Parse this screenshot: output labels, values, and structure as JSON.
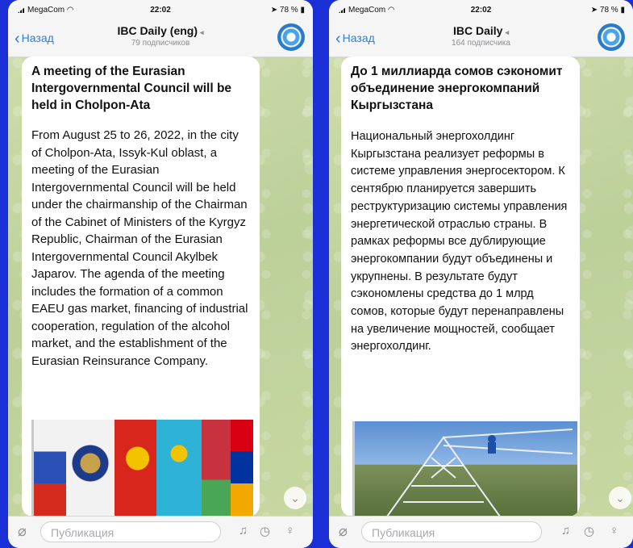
{
  "left": {
    "status": {
      "carrier": "MegaCom",
      "time": "22:02",
      "battery": "78 %"
    },
    "nav": {
      "back": "Назад",
      "title": "IBC Daily (eng)",
      "subscribers": "79 подписчиков"
    },
    "post": {
      "title": "A meeting of the Eurasian Intergovernmental Council will be held in Cholpon-Ata",
      "body": "From August 25 to 26, 2022, in the city of Cholpon-Ata, Issyk-Kul oblast, a meeting of the Eurasian Intergovernmental Council will be held under the chairmanship of the Chairman of the Cabinet of Ministers of the Kyrgyz Republic, Chairman of the Eurasian Intergovernmental Council Akylbek Japarov. The agenda of the meeting includes the formation of a common EAEU gas market, financing of industrial cooperation, regulation of the alcohol market, and the establishment of the Eurasian Reinsurance Company."
    },
    "input": {
      "placeholder": "Публикация"
    }
  },
  "right": {
    "status": {
      "carrier": "MegaCom",
      "time": "22:02",
      "battery": "78 %"
    },
    "nav": {
      "back": "Назад",
      "title": "IBC Daily",
      "subscribers": "164 подписчика"
    },
    "post": {
      "title": "До 1 миллиарда сомов сэкономит объединение энергокомпаний Кыргызстана",
      "body": "Национальный энергохолдинг Кыргызстана реализует реформы в системе управления энергосектором. К сентябрю планируется завершить реструктуризацию системы управления энергетической отраслью страны. В рамках реформы все дублирующие энергокомпании будут объединены и укрупнены. В результате будут сэкономлены средства до 1 млрд сомов, которые будут перенаправлены на увеличение мощностей, сообщает энергохолдинг."
    },
    "input": {
      "placeholder": "Публикация"
    }
  },
  "colors": {
    "accent": "#2f7de1",
    "background": "#1a2fd6",
    "chat_wallpaper": "#c7d7a4"
  },
  "icons": [
    "back-chevron-icon",
    "mute-icon",
    "channel-avatar",
    "chevron-down-icon",
    "paperclip-icon",
    "bell-icon",
    "clock-icon",
    "microphone-icon"
  ]
}
